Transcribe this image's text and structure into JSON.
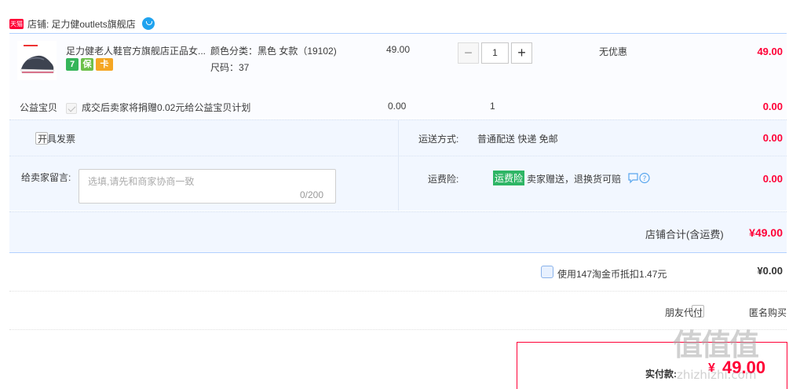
{
  "shop": {
    "badge": "天猫",
    "label": "店铺:",
    "name": "足力健outlets旗舰店"
  },
  "item": {
    "title": "足力健老人鞋官方旗舰店正品女...",
    "sku_color": "颜色分类：黑色 女款（19102)",
    "sku_size": "尺码：37",
    "service_icons": [
      "7",
      "保",
      "卡"
    ],
    "price": "49.00",
    "quantity": "1",
    "qty_minus": "−",
    "qty_plus": "+",
    "discount": "无优惠",
    "subtotal": "49.00"
  },
  "charity": {
    "label": "公益宝贝",
    "text": "成交后卖家将捐赠0.02元给公益宝贝计划",
    "price": "0.00",
    "quantity": "1",
    "subtotal": "0.00"
  },
  "options": {
    "invoice_label": "开具发票",
    "shipping_label": "运送方式:",
    "shipping_value": "普通配送 快递 免邮",
    "shipping_fee": "0.00",
    "memo_label": "给卖家留言:",
    "memo_placeholder": "选填,请先和商家协商一致",
    "memo_count": "0/200",
    "insurance_label": "运费险:",
    "insurance_tag": "运费险",
    "insurance_text": "卖家赠送，退换货可赔",
    "insurance_fee": "0.00",
    "extra_fee": "0.00"
  },
  "shop_total": {
    "label": "店铺合计(含运费)",
    "value": "¥49.00"
  },
  "coins": {
    "text": "使用147淘金币抵扣1.47元",
    "value": "¥0.00"
  },
  "pay_options": {
    "friend_pay": "朋友代付",
    "anonymous": "匿名购买"
  },
  "actual_pay": {
    "label": "实付款:",
    "currency": "¥",
    "value": "49.00"
  },
  "watermark": {
    "glyphs": "值值值",
    "site": "zhizhizhi.com"
  },
  "colors": {
    "price_red": "#ff0036",
    "accent_blue": "#3a86e5",
    "insurance_green": "#2eb565",
    "band_blue": "#f2f7ff"
  }
}
